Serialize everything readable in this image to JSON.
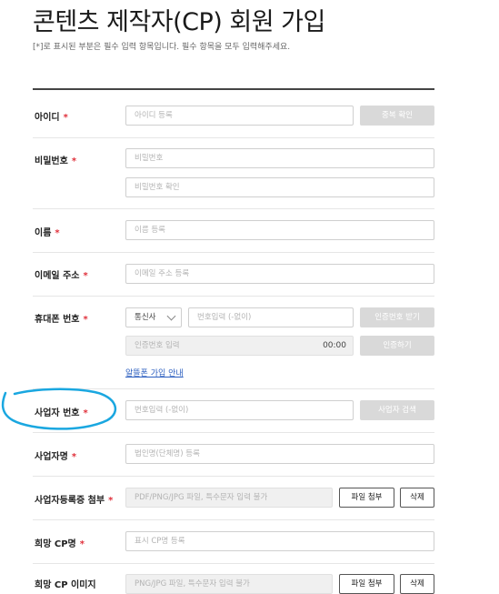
{
  "page": {
    "title": "콘텐츠 제작자(CP) 회원 가입",
    "notice": "[*]로 표시된 부분은 필수 입력 항목입니다. 필수 항목을 모두 입력해주세요."
  },
  "form": {
    "required_mark": "*",
    "id": {
      "label": "아이디",
      "placeholder": "아이디 등록",
      "check_button": "중복 확인"
    },
    "password": {
      "label": "비밀번호",
      "placeholder": "비밀번호",
      "confirm_placeholder": "비밀번호 확인"
    },
    "name": {
      "label": "이름",
      "placeholder": "이름 등록"
    },
    "email": {
      "label": "이메일 주소",
      "placeholder": "이메일 주소 등록"
    },
    "phone": {
      "label": "휴대폰 번호",
      "carrier_selected": "통신사",
      "number_placeholder": "번호입력 (-없이)",
      "request_button": "인증번호 받기",
      "code_placeholder": "인증번호 입력",
      "timer": "00:00",
      "verify_button": "인증하기",
      "guide_link": "알뜰폰 가입 안내"
    },
    "business_number": {
      "label": "사업자 번호",
      "placeholder": "번호입력 (-없이)",
      "search_button": "사업자 검색"
    },
    "business_name": {
      "label": "사업자명",
      "placeholder": "법인명(단체명) 등록"
    },
    "business_cert": {
      "label": "사업자등록증 첨부",
      "placeholder": "PDF/PNG/JPG 파일, 특수문자 입력 불가",
      "attach_button": "파일 첨부",
      "delete_button": "삭제"
    },
    "cp_name": {
      "label": "희망 CP명",
      "placeholder": "표시 CP명 등록"
    },
    "cp_image": {
      "label": "희망 CP 이미지",
      "placeholder": "PNG/JPG 파일, 특수문자 입력 불가",
      "attach_button": "파일 첨부",
      "delete_button": "삭제"
    }
  },
  "colors": {
    "required": "#e0303b",
    "annotation": "#1aa7e0",
    "link": "#2a5dbf"
  }
}
